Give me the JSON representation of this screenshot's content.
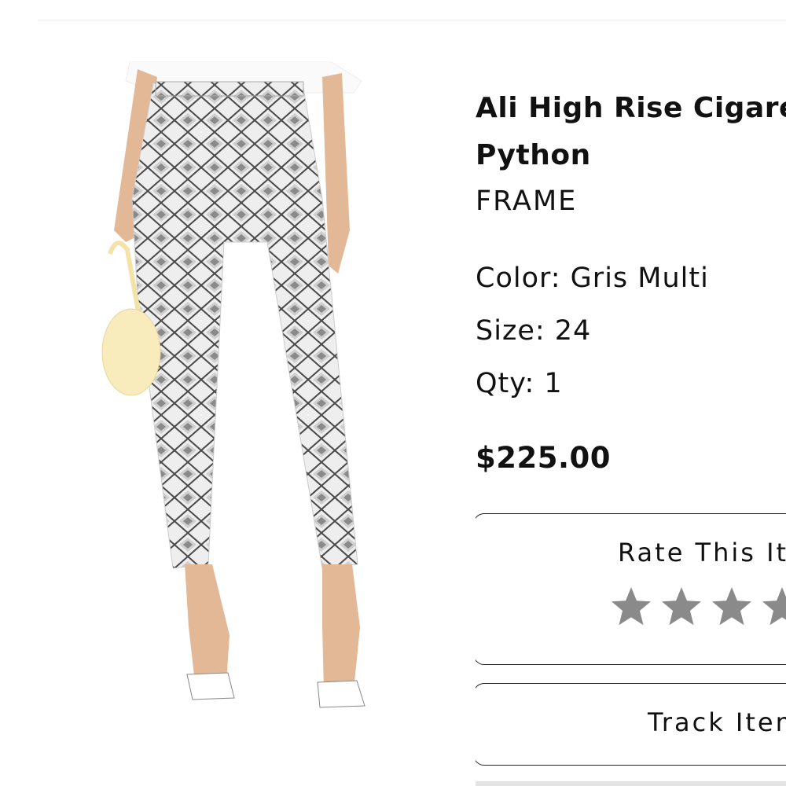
{
  "product": {
    "title_line1": "Ali High Rise Cigarette",
    "title_line2": "Python",
    "brand": "FRAME",
    "color_label": "Color: Gris Multi",
    "size_label": "Size: 24",
    "qty_label": "Qty: 1",
    "price": "$225.00"
  },
  "rating": {
    "label": "Rate This Item",
    "stars_total": 5,
    "stars_filled": 0,
    "star_color": "#8a8a8a"
  },
  "actions": {
    "track_label": "Track Item"
  },
  "icons": {
    "star": "star-icon"
  }
}
